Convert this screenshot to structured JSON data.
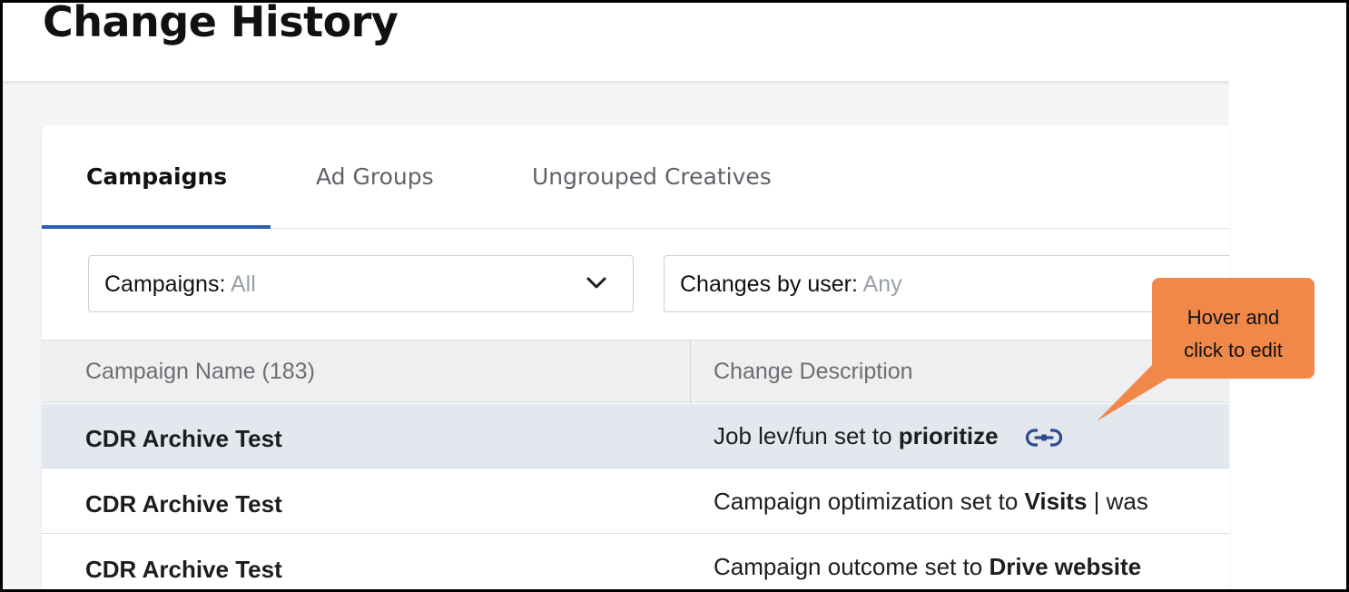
{
  "page": {
    "title": "Change History"
  },
  "tabs": [
    {
      "label": "Campaigns",
      "active": true
    },
    {
      "label": "Ad Groups",
      "active": false
    },
    {
      "label": "Ungrouped Creatives",
      "active": false
    }
  ],
  "filters": {
    "campaigns": {
      "label": "Campaigns:",
      "value": "All",
      "icon": "chevron-down-icon"
    },
    "user": {
      "label": "Changes by user:",
      "value": "Any"
    }
  },
  "table": {
    "columns": [
      "Campaign Name (183)",
      "Change Description"
    ],
    "rows": [
      {
        "name": "CDR Archive Test",
        "desc_prefix": "Job lev/fun set to ",
        "desc_bold": "prioritize",
        "desc_suffix": "",
        "highlighted": true,
        "icon": "link-icon"
      },
      {
        "name": "CDR Archive Test",
        "desc_prefix": "Campaign optimization set to ",
        "desc_bold": "Visits",
        "desc_suffix": " | was",
        "highlighted": false
      },
      {
        "name": "CDR Archive Test",
        "desc_prefix": "Campaign outcome set to ",
        "desc_bold": "Drive website",
        "desc_suffix": "",
        "highlighted": false
      }
    ]
  },
  "callout": {
    "line1": "Hover and",
    "line2": "click to edit"
  },
  "colors": {
    "accent": "#2b5fb4",
    "callout": "#f0884a",
    "row_highlight": "#e3e8ef"
  }
}
